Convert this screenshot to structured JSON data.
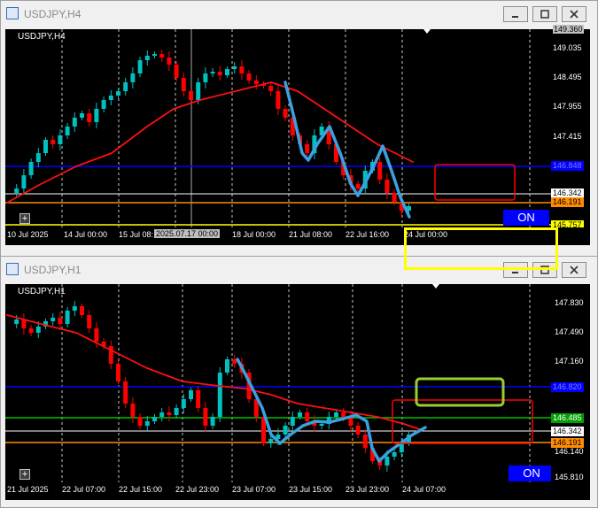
{
  "windows": [
    {
      "id": "h4",
      "title": "USDJPY,H4",
      "symbol_label": "USDJPY,H4",
      "price_labels": [
        "149.360",
        "149.035",
        "148.495",
        "147.955",
        "147.415"
      ],
      "tags": [
        {
          "text": "146.848",
          "bg": "#0000ff",
          "fg": "#7f7fff"
        },
        {
          "text": "146.342",
          "bg": "#ffffff",
          "fg": "#000000"
        },
        {
          "text": "146.191",
          "bg": "#ff8c00",
          "fg": "#000000"
        },
        {
          "text": "145.757",
          "bg": "#ffff00",
          "fg": "#000000"
        }
      ],
      "time_labels": [
        "10 Jul 2025",
        "14 Jul 00:00",
        "15 Jul 08:",
        "2025.07.17 00:00",
        "18 Jul 00:00",
        "21 Jul 08:00",
        "22 Jul 16:00",
        "24 Jul 00:00"
      ],
      "on_label": "ON"
    },
    {
      "id": "h1",
      "title": "USDJPY,H1",
      "symbol_label": "USDJPY,H1",
      "price_labels": [
        "147.830",
        "147.490",
        "147.160",
        "146.140",
        "145.810"
      ],
      "tags": [
        {
          "text": "146.820",
          "bg": "#0000ff",
          "fg": "#7f7fff"
        },
        {
          "text": "146.485",
          "bg": "#00a000",
          "fg": "#ffffff"
        },
        {
          "text": "146.342",
          "bg": "#ffffff",
          "fg": "#000000"
        },
        {
          "text": "146.191",
          "bg": "#ff8c00",
          "fg": "#000000"
        }
      ],
      "time_labels": [
        "21 Jul 2025",
        "22 Jul 07:00",
        "22 Jul 15:00",
        "22 Jul 23:00",
        "23 Jul 07:00",
        "23 Jul 15:00",
        "23 Jul 23:00",
        "24 Jul 07:00"
      ],
      "on_label": "ON"
    }
  ],
  "colors": {
    "bull": "#00c0c0",
    "bear": "#ff0000",
    "ma": "#ff1010",
    "blue_line": "#0000ff",
    "orange_line": "#ff8c00",
    "green_line": "#00c000",
    "white_line": "#ffffff",
    "highlight": "#3aa0e0",
    "yellow_box": "#ffff00",
    "green_box": "#9acd32",
    "red_box": "#ff0000"
  }
}
